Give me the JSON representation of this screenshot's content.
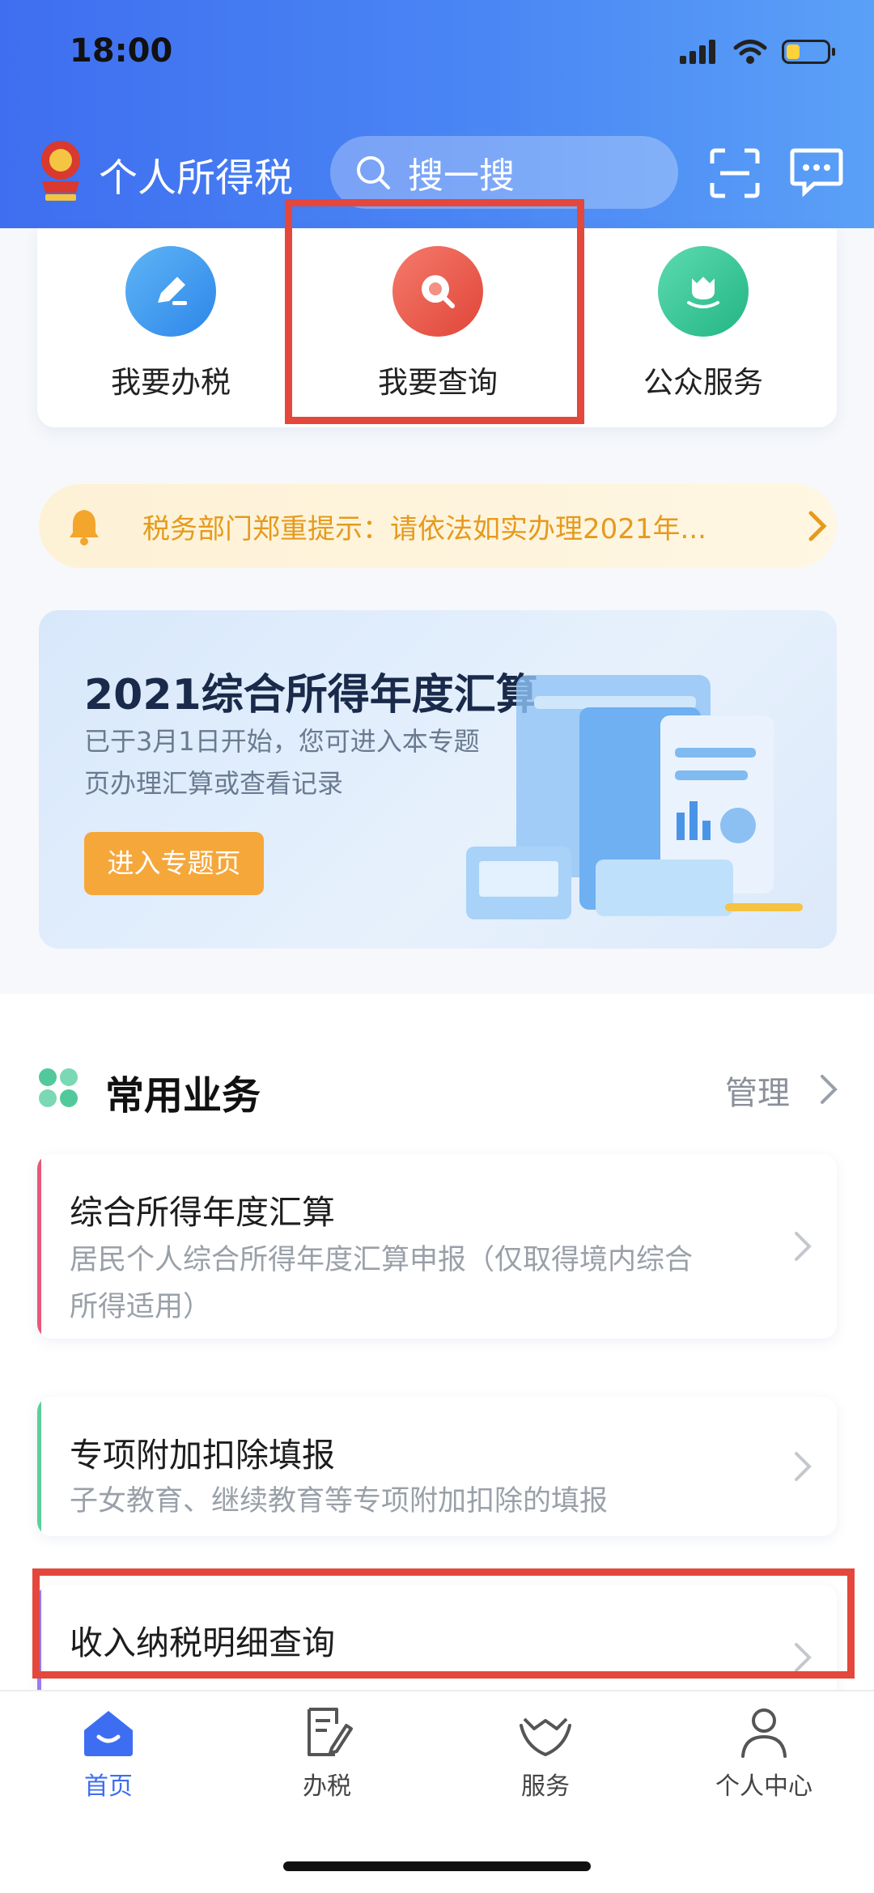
{
  "status_bar": {
    "time": "18:00"
  },
  "header": {
    "app_title": "个人所得税",
    "search_placeholder": "搜一搜"
  },
  "quick_actions": [
    {
      "label": "我要办税",
      "icon": "pencil-icon",
      "color": "#3f9bf0"
    },
    {
      "label": "我要查询",
      "icon": "search-icon",
      "color": "#ec5a4c"
    },
    {
      "label": "公众服务",
      "icon": "tulip-icon",
      "color": "#3cc79d"
    }
  ],
  "notice": {
    "text": "税务部门郑重提示：请依法如实办理2021年..."
  },
  "banner": {
    "title": "2021综合所得年度汇算",
    "description_line1": "已于3月1日开始，您可进入本专题",
    "description_line2": "页办理汇算或查看记录",
    "button_label": "进入专题页"
  },
  "common_business": {
    "title": "常用业务",
    "manage_label": "管理",
    "items": [
      {
        "title": "综合所得年度汇算",
        "desc_line1": "居民个人综合所得年度汇算申报（仅取得境内综合",
        "desc_line2": "所得适用）",
        "accent": "#e8577a"
      },
      {
        "title": "专项附加扣除填报",
        "desc_line1": "子女教育、继续教育等专项附加扣除的填报",
        "accent": "#5ccf9a"
      },
      {
        "title": "收入纳税明细查询",
        "accent": "#9b7bf0"
      }
    ]
  },
  "tabbar": {
    "tabs": [
      {
        "label": "首页",
        "icon": "home-icon",
        "active": true
      },
      {
        "label": "办税",
        "icon": "document-edit-icon",
        "active": false
      },
      {
        "label": "服务",
        "icon": "heart-hands-icon",
        "active": false
      },
      {
        "label": "个人中心",
        "icon": "person-icon",
        "active": false
      }
    ]
  },
  "colors": {
    "primary": "#3d6ef2",
    "highlight": "#e4473b",
    "notice": "#e69a1c"
  }
}
